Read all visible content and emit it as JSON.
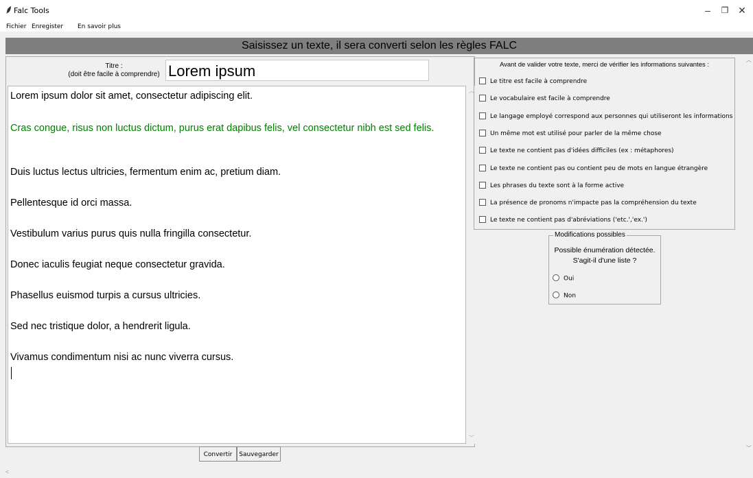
{
  "window": {
    "title": "Falc Tools",
    "minimize": "–",
    "restore": "❐",
    "close": "✕"
  },
  "menu": [
    "Fichier",
    "Enregister",
    "En savoir plus"
  ],
  "banner": "Saisissez un texte, il sera converti selon les règles FALC",
  "title_field": {
    "label_line1": "Titre :",
    "label_line2": "(doit être facile à comprendre)",
    "value": "Lorem ipsum"
  },
  "text_paragraphs": [
    {
      "text": "Lorem ipsum dolor sit amet, consectetur adipiscing elit.",
      "color": "#000000"
    },
    {
      "text": "Cras congue, risus non luctus dictum, purus erat dapibus felis, vel consectetur nibh est sed felis.",
      "color": "#008000"
    },
    {
      "text": "Duis luctus lectus ultricies, fermentum enim ac, pretium diam.",
      "color": "#000000"
    },
    {
      "text": "Pellentesque id orci massa.",
      "color": "#000000"
    },
    {
      "text": "Vestibulum varius purus quis nulla fringilla consectetur.",
      "color": "#000000"
    },
    {
      "text": "Donec iaculis feugiat neque consectetur gravida.",
      "color": "#000000"
    },
    {
      "text": "Phasellus euismod turpis a cursus ultricies.",
      "color": "#000000"
    },
    {
      "text": "Sed nec tristique dolor, a hendrerit ligula.",
      "color": "#000000"
    },
    {
      "text": "Vivamus condimentum nisi ac nunc viverra cursus.",
      "color": "#000000"
    }
  ],
  "buttons": {
    "convert": "Convertir",
    "save": "Sauvegarder"
  },
  "checklist": {
    "header": "Avant de valider votre texte, merci de vérifier les informations suivantes :",
    "items": [
      "Le titre est facile à comprendre",
      "Le vocabulaire est facile à comprendre",
      "Le langage employé correspond aux personnes qui utiliseront les informations",
      "Un même mot est utilisé pour parler de la même chose",
      "Le texte ne contient pas d'idées difficiles (ex : métaphores)",
      "Le texte ne contient pas ou contient peu de mots en langue étrangère",
      "Les phrases du texte sont à la forme active",
      "La présence de pronoms n'impacte pas la compréhension du texte",
      "Le texte ne contient pas d'abréviations ('etc.','ex.')"
    ]
  },
  "modifications": {
    "title": "Modifications possibles",
    "line1": "Possible énumération détectée.",
    "line2": "S'agit-il d'une liste ?",
    "options": [
      "Oui",
      "Non"
    ]
  },
  "colors": {
    "banner": "#7f7f7f",
    "highlight_text": "#008000"
  }
}
